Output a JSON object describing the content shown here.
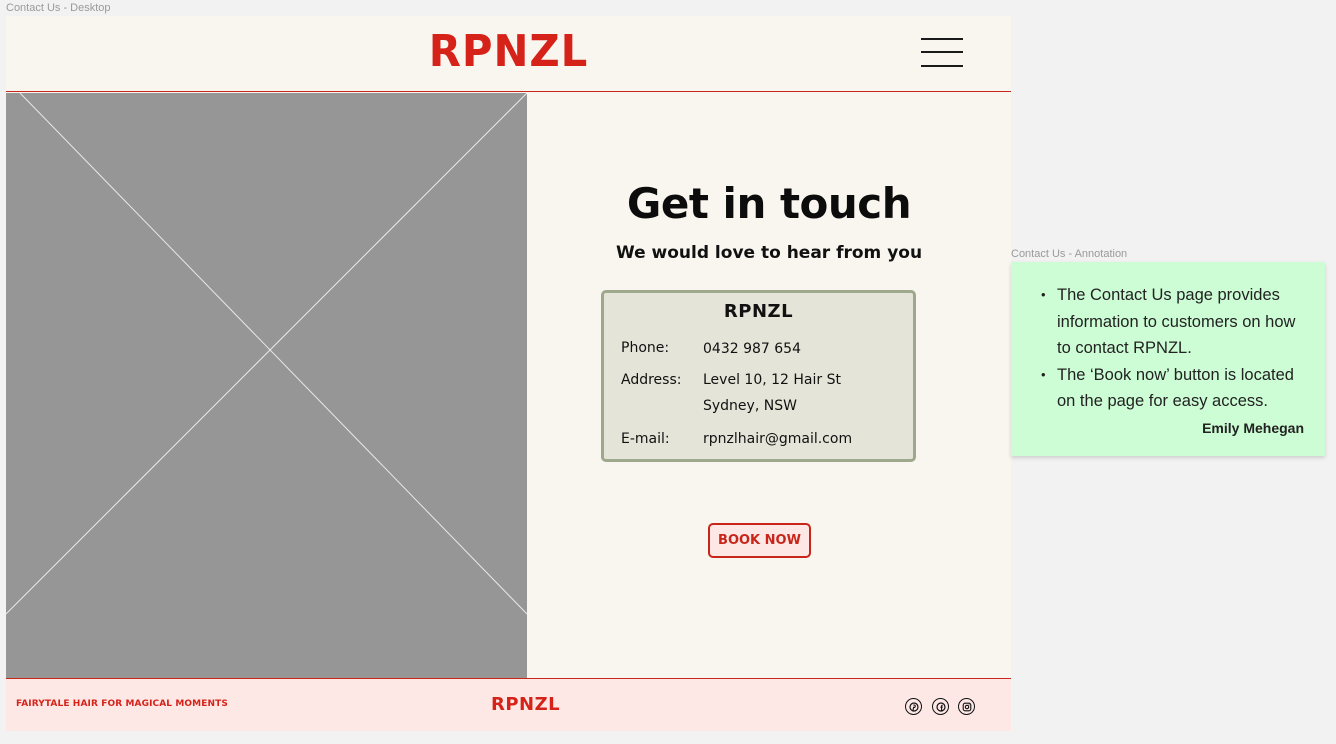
{
  "frame_labels": {
    "desktop": "Contact Us - Desktop",
    "annotation": "Contact Us - Annotation"
  },
  "header": {
    "logo": "RPNZL",
    "menu_icon": "hamburger-menu-icon"
  },
  "hero_image": {
    "icon": "image-placeholder-icon"
  },
  "contact": {
    "title": "Get in touch",
    "subtitle": "We would love to hear from you",
    "card": {
      "title": "RPNZL",
      "phone_label": "Phone:",
      "phone_value": "0432 987 654",
      "address_label": "Address:",
      "address_line1": "Level 10, 12 Hair St",
      "address_line2": "Sydney, NSW",
      "email_label": "E-mail:",
      "email_value": "rpnzlhair@gmail.com"
    },
    "book_button": "BOOK NOW"
  },
  "footer": {
    "tagline": "FAIRYTALE HAIR FOR MAGICAL MOMENTS",
    "logo": "RPNZL",
    "social_icons": [
      "pinterest-icon",
      "facebook-icon",
      "instagram-icon"
    ]
  },
  "annotation": {
    "bullets": [
      "The Contact Us page provides information to customers on how to contact RPNZL.",
      "The ‘Book now’ button is located on the page for easy access."
    ],
    "author": "Emily Mehegan"
  },
  "colors": {
    "brand_red": "#d6231a",
    "background": "#f9f6ef",
    "footer_bg": "#fde8e6",
    "card_bg": "#e4e5d8",
    "card_border": "#9ea88c",
    "note_bg": "#cdfdd5",
    "placeholder_gray": "#969696"
  }
}
